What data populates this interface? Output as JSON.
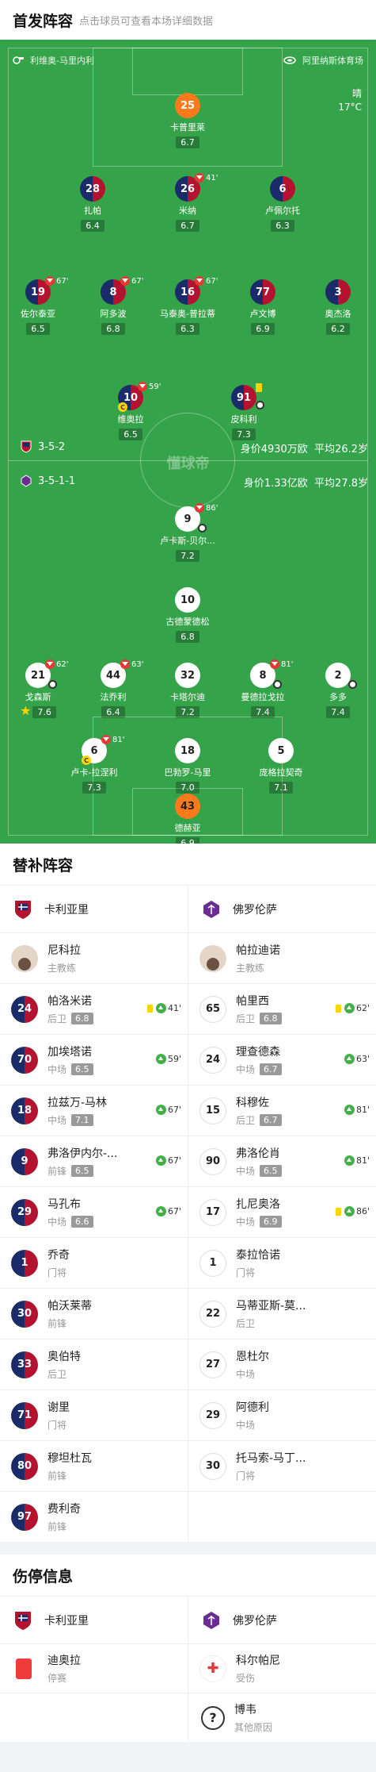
{
  "header": {
    "title": "首发阵容",
    "subtitle": "点击球员可查看本场详细数据"
  },
  "venue": {
    "coach_home": "利维奥-马里内利",
    "stadium": "阿里纳斯体育场",
    "weather": "晴",
    "temp": "17°C"
  },
  "watermark": "懂球帝",
  "home_formation": {
    "formation": "3-5-2",
    "value": "身价4930万欧",
    "age": "平均26.2岁"
  },
  "away_formation": {
    "formation": "3-5-1-1",
    "value": "身价1.33亿欧",
    "age": "平均27.8岁"
  },
  "home_players": [
    {
      "num": "25",
      "name": "卡普里莱",
      "rating": "6.7"
    },
    {
      "num": "28",
      "name": "扎帕",
      "rating": "6.4"
    },
    {
      "num": "26",
      "name": "米纳",
      "rating": "6.7",
      "sub": "41'"
    },
    {
      "num": "6",
      "name": "卢佩尔托",
      "rating": "6.3"
    },
    {
      "num": "19",
      "name": "佐尔泰亚",
      "rating": "6.5",
      "sub": "67'"
    },
    {
      "num": "8",
      "name": "阿多波",
      "rating": "6.8",
      "sub": "67'"
    },
    {
      "num": "16",
      "name": "马泰奥-普拉蒂",
      "rating": "6.3",
      "sub": "67'"
    },
    {
      "num": "77",
      "name": "卢文博",
      "rating": "6.9"
    },
    {
      "num": "3",
      "name": "奥杰洛",
      "rating": "6.2"
    },
    {
      "num": "10",
      "name": "维奥拉",
      "rating": "6.5",
      "sub": "59'",
      "captain": "C"
    },
    {
      "num": "91",
      "name": "皮科利",
      "rating": "7.3"
    }
  ],
  "away_players": [
    {
      "num": "9",
      "name": "卢卡斯-贝尔...",
      "rating": "7.2",
      "sub": "86'"
    },
    {
      "num": "10",
      "name": "古德蒙德松",
      "rating": "6.8"
    },
    {
      "num": "21",
      "name": "戈森斯",
      "rating": "7.6",
      "sub": "62'"
    },
    {
      "num": "44",
      "name": "法乔利",
      "rating": "6.4",
      "sub": "63'"
    },
    {
      "num": "32",
      "name": "卡塔尔迪",
      "rating": "7.2"
    },
    {
      "num": "8",
      "name": "曼德拉戈拉",
      "rating": "7.4",
      "sub": "81'"
    },
    {
      "num": "2",
      "name": "多多",
      "rating": "7.4"
    },
    {
      "num": "6",
      "name": "卢卡-拉涅利",
      "rating": "7.3",
      "sub": "81'",
      "captain": "C"
    },
    {
      "num": "18",
      "name": "巴勃罗-马里",
      "rating": "7.0"
    },
    {
      "num": "5",
      "name": "庞格拉契奇",
      "rating": "7.1"
    },
    {
      "num": "43",
      "name": "德赫亚",
      "rating": "6.9"
    }
  ],
  "subs": {
    "title": "替补阵容",
    "home_team": "卡利亚里",
    "away_team": "佛罗伦萨",
    "home_coach": {
      "name": "尼科拉",
      "role": "主教练"
    },
    "away_coach": {
      "name": "帕拉迪诺",
      "role": "主教练"
    },
    "rows": [
      {
        "h": {
          "num": "24",
          "name": "帕洛米诺",
          "pos": "后卫",
          "rating": "6.8",
          "time": "41'",
          "yellow": true
        },
        "a": {
          "num": "65",
          "name": "帕里西",
          "pos": "后卫",
          "rating": "6.8",
          "time": "62'",
          "yellow": true
        }
      },
      {
        "h": {
          "num": "70",
          "name": "加埃塔诺",
          "pos": "中场",
          "rating": "6.5",
          "time": "59'"
        },
        "a": {
          "num": "24",
          "name": "理查德森",
          "pos": "中场",
          "rating": "6.7",
          "time": "63'"
        }
      },
      {
        "h": {
          "num": "18",
          "name": "拉兹万-马林",
          "pos": "中场",
          "rating": "7.1",
          "time": "67'"
        },
        "a": {
          "num": "15",
          "name": "科穆佐",
          "pos": "后卫",
          "rating": "6.7",
          "time": "81'"
        }
      },
      {
        "h": {
          "num": "9",
          "name": "弗洛伊内尔-...",
          "pos": "前锋",
          "rating": "6.5",
          "time": "67'"
        },
        "a": {
          "num": "90",
          "name": "弗洛伦肖",
          "pos": "中场",
          "rating": "6.5",
          "time": "81'"
        }
      },
      {
        "h": {
          "num": "29",
          "name": "马孔布",
          "pos": "中场",
          "rating": "6.6",
          "time": "67'"
        },
        "a": {
          "num": "17",
          "name": "扎尼奥洛",
          "pos": "中场",
          "rating": "6.9",
          "time": "86'",
          "yellow": true
        }
      },
      {
        "h": {
          "num": "1",
          "name": "乔奇",
          "pos": "门将"
        },
        "a": {
          "num": "1",
          "name": "泰拉恰诺",
          "pos": "门将"
        }
      },
      {
        "h": {
          "num": "30",
          "name": "帕沃莱蒂",
          "pos": "前锋"
        },
        "a": {
          "num": "22",
          "name": "马蒂亚斯-莫...",
          "pos": "后卫"
        }
      },
      {
        "h": {
          "num": "33",
          "name": "奥伯特",
          "pos": "后卫"
        },
        "a": {
          "num": "27",
          "name": "恩杜尔",
          "pos": "中场"
        }
      },
      {
        "h": {
          "num": "71",
          "name": "谢里",
          "pos": "门将"
        },
        "a": {
          "num": "29",
          "name": "阿德利",
          "pos": "中场"
        }
      },
      {
        "h": {
          "num": "80",
          "name": "穆坦杜瓦",
          "pos": "前锋"
        },
        "a": {
          "num": "30",
          "name": "托马索-马丁...",
          "pos": "门将"
        }
      },
      {
        "h": {
          "num": "97",
          "name": "费利奇",
          "pos": "前锋"
        }
      }
    ]
  },
  "injury": {
    "title": "伤停信息",
    "home_team": "卡利亚里",
    "away_team": "佛罗伦萨",
    "home": [
      {
        "name": "迪奥拉",
        "reason": "停赛"
      }
    ],
    "away": [
      {
        "name": "科尔帕尼",
        "reason": "受伤"
      },
      {
        "name": "博韦",
        "reason": "其他原因"
      }
    ]
  }
}
